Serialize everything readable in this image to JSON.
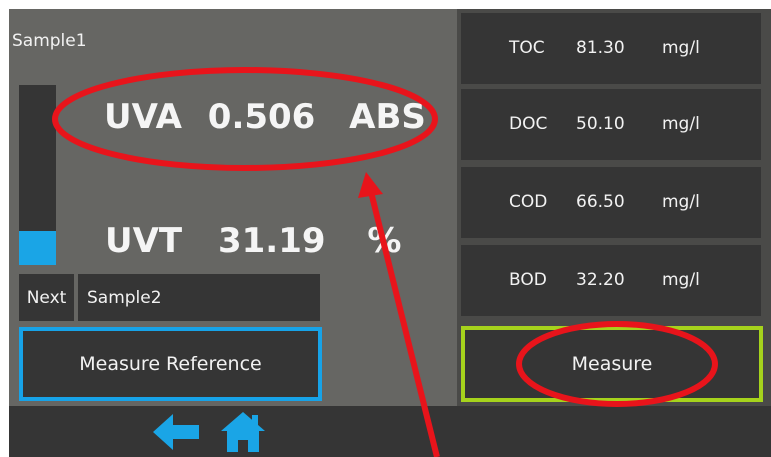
{
  "sample": {
    "name": "Sample1"
  },
  "level_bar": {
    "fill_fraction": 0.19,
    "color": "#1aa5e6"
  },
  "uva": {
    "label": "UVA",
    "value": "0.506",
    "unit": "ABS"
  },
  "uvt": {
    "label": "UVT",
    "value": "31.19",
    "unit": "%"
  },
  "next": {
    "label": "Next",
    "value": "Sample2"
  },
  "buttons": {
    "measure_reference": "Measure Reference",
    "measure": "Measure"
  },
  "parameters": [
    {
      "name": "TOC",
      "value": "81.30",
      "unit": "mg/l"
    },
    {
      "name": "DOC",
      "value": "50.10",
      "unit": "mg/l"
    },
    {
      "name": "COD",
      "value": "66.50",
      "unit": "mg/l"
    },
    {
      "name": "BOD",
      "value": "32.20",
      "unit": "mg/l"
    }
  ],
  "icons": {
    "back": "arrow-left-icon",
    "home": "home-icon"
  },
  "colors": {
    "accent_blue": "#1aa5e6",
    "accent_green": "#a6d31c",
    "annotation_red": "#e8141b"
  }
}
